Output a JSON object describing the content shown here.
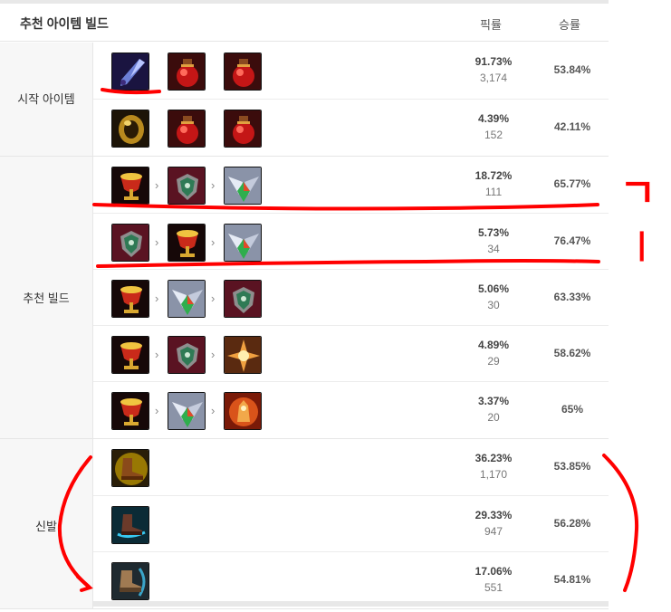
{
  "header": {
    "title": "추천 아이템 빌드",
    "pick_col": "픽률",
    "win_col": "승률"
  },
  "groups": [
    {
      "label": "시작 아이템",
      "rows": [
        {
          "items": [
            "dark-seal-icon",
            "health-potion-icon",
            "health-potion-icon"
          ],
          "arrows": false,
          "pick": "91.73%",
          "count": "3,174",
          "win": "53.84%"
        },
        {
          "items": [
            "gold-ring-icon",
            "health-potion-icon",
            "health-potion-icon"
          ],
          "arrows": false,
          "pick": "4.39%",
          "count": "152",
          "win": "42.11%"
        }
      ]
    },
    {
      "label": "추천 빌드",
      "rows": [
        {
          "items": [
            "chalice-icon",
            "shield-relic-icon",
            "winged-crystal-icon"
          ],
          "arrows": true,
          "pick": "18.72%",
          "count": "111",
          "win": "65.77%"
        },
        {
          "items": [
            "shield-relic-icon",
            "chalice-icon",
            "winged-crystal-icon"
          ],
          "arrows": true,
          "pick": "5.73%",
          "count": "34",
          "win": "76.47%"
        },
        {
          "items": [
            "chalice-icon",
            "winged-crystal-icon",
            "shield-relic-icon"
          ],
          "arrows": true,
          "pick": "5.06%",
          "count": "30",
          "win": "63.33%"
        },
        {
          "items": [
            "chalice-icon",
            "shield-relic-icon",
            "sun-emblem-icon"
          ],
          "arrows": true,
          "pick": "4.89%",
          "count": "29",
          "win": "58.62%"
        },
        {
          "items": [
            "chalice-icon",
            "winged-crystal-icon",
            "golden-idol-icon"
          ],
          "arrows": true,
          "pick": "3.37%",
          "count": "20",
          "win": "65%"
        }
      ]
    },
    {
      "label": "신발",
      "rows": [
        {
          "items": [
            "swift-boots-icon"
          ],
          "arrows": false,
          "pick": "36.23%",
          "count": "1,170",
          "win": "53.85%"
        },
        {
          "items": [
            "ionian-boots-icon"
          ],
          "arrows": false,
          "pick": "29.33%",
          "count": "947",
          "win": "56.28%"
        },
        {
          "items": [
            "sorcerer-boots-icon"
          ],
          "arrows": false,
          "pick": "17.06%",
          "count": "551",
          "win": "54.81%"
        }
      ]
    }
  ],
  "annotation_color": "#ff0000",
  "annotation_text": [
    "ㄱ",
    "ㅣ"
  ]
}
